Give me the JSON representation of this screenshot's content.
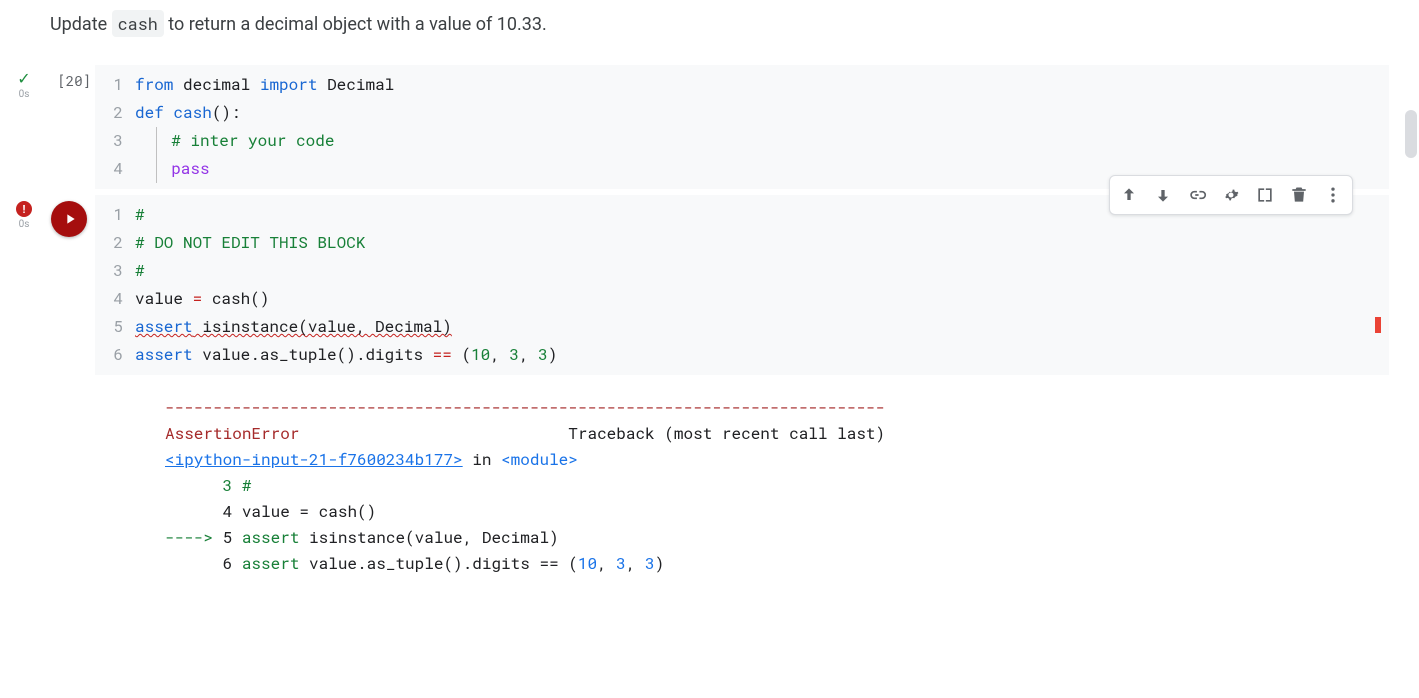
{
  "markdown": {
    "text_before": "Update ",
    "code": "cash",
    "text_after": " to return a decimal object with a value of 10.33."
  },
  "cell1": {
    "exec_count": "[20]",
    "timing": "0s",
    "lines": [
      "1",
      "2",
      "3",
      "4"
    ],
    "code": {
      "l1": {
        "from": "from",
        "mod": "decimal",
        "imp": "import",
        "name": "Decimal"
      },
      "l2": {
        "def": "def",
        "fn": "cash",
        "parens": "():"
      },
      "l3": {
        "cmt": "# inter your code"
      },
      "l4": {
        "pass": "pass"
      }
    }
  },
  "cell2": {
    "timing": "0s",
    "lines": [
      "1",
      "2",
      "3",
      "4",
      "5",
      "6"
    ],
    "code": {
      "l1": "#",
      "l2": "# DO NOT EDIT THIS BLOCK",
      "l3": "#",
      "l4": {
        "lhs": "value ",
        "op": "=",
        "rhs": " cash()"
      },
      "l5": {
        "assert": "assert",
        "call": " isinstance(value, Decimal)"
      },
      "l6": {
        "assert": "assert",
        "body": " value.as_tuple().digits ",
        "op": "==",
        "tuple": " (",
        "n1": "10",
        "c1": ", ",
        "n2": "3",
        "c2": ", ",
        "n3": "3",
        "close": ")"
      }
    },
    "output": {
      "dashes": "---------------------------------------------------------------------------",
      "exc_name": "AssertionError",
      "tb_label": "Traceback (most recent call last)",
      "link": "<ipython-input-21-f7600234b177>",
      "in": " in ",
      "module": "<module>",
      "l3": "      3 #",
      "l4_pre": "      4 value ",
      "l4_op": "=",
      "l4_post": " cash()",
      "arrow": "----> ",
      "l5_num": "5 ",
      "l5_kw": "assert",
      "l5_body": " isinstance(value, Decimal)",
      "l6_pre": "      6 ",
      "l6_kw": "assert",
      "l6_body": " value.as_tuple().digits ",
      "l6_op": "==",
      "l6_tuple_open": " (",
      "l6_n1": "10",
      "l6_c1": ", ",
      "l6_n2": "3",
      "l6_c2": ", ",
      "l6_n3": "3",
      "l6_close": ")"
    }
  },
  "toolbar": {
    "move_up": "Move cell up",
    "move_down": "Move cell down",
    "link": "Link to cell",
    "settings": "Edit cell",
    "mirror": "Mirror cell",
    "delete": "Delete cell",
    "more": "More actions"
  }
}
